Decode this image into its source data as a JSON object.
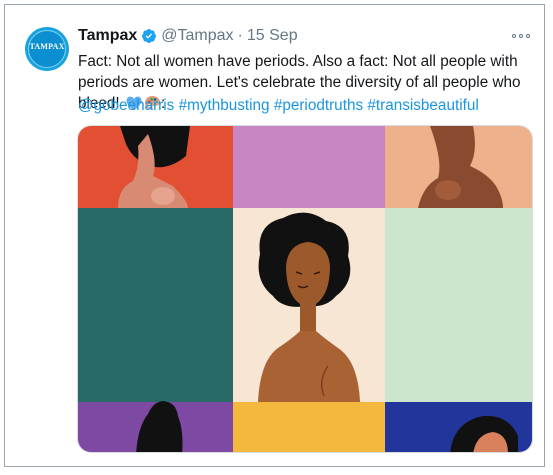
{
  "tweet": {
    "avatar_text": "TAMPAX",
    "name": "Tampax",
    "handle": "@Tampax",
    "separator": "·",
    "date": "15 Sep",
    "text": "Fact: Not all women have periods. Also a fact: Not all people with periods are women. Let's celebrate the diversity of all people who bleed!",
    "mention": "@gobeeharris",
    "hashtags": [
      "#mythbusting",
      "#periodtruths",
      "#transisbeautiful"
    ],
    "emoji_colon": ":",
    "emojis": [
      "blue-heart-icon",
      "artist-palette-icon"
    ]
  },
  "colors": {
    "link": "#1b95e0",
    "secondary_text": "#657786",
    "verified": "#1da1f2",
    "avatar_bg": "#0c8fd0"
  },
  "media": {
    "panel_colors": [
      "#e24f33",
      "#c787c2",
      "#efb08c",
      "#286b66",
      "#f6e6d3",
      "#cbe6cd",
      "#7e49a3",
      "#f3b83d",
      "#22359a"
    ]
  }
}
